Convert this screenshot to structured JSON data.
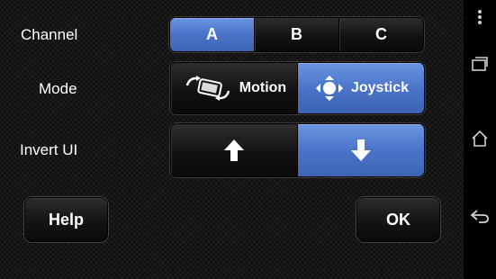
{
  "rows": {
    "channel": {
      "label": "Channel",
      "options": [
        {
          "label": "A",
          "selected": true
        },
        {
          "label": "B",
          "selected": false
        },
        {
          "label": "C",
          "selected": false
        }
      ]
    },
    "mode": {
      "label": "Mode",
      "options": [
        {
          "label": "Motion",
          "icon": "phone-rotate-icon",
          "selected": false
        },
        {
          "label": "Joystick",
          "icon": "joystick-icon",
          "selected": true
        }
      ]
    },
    "invert_ui": {
      "label": "Invert UI",
      "options": [
        {
          "icon": "arrow-up-icon",
          "selected": false
        },
        {
          "icon": "arrow-down-icon",
          "selected": true
        }
      ]
    }
  },
  "buttons": {
    "help": "Help",
    "ok": "OK"
  },
  "navbar": {
    "icons": [
      "overflow-menu-icon",
      "recent-apps-icon",
      "home-icon",
      "back-icon"
    ]
  },
  "colors": {
    "active_segment": "#4a74c9",
    "background": "#161616",
    "text": "#ffffff"
  }
}
